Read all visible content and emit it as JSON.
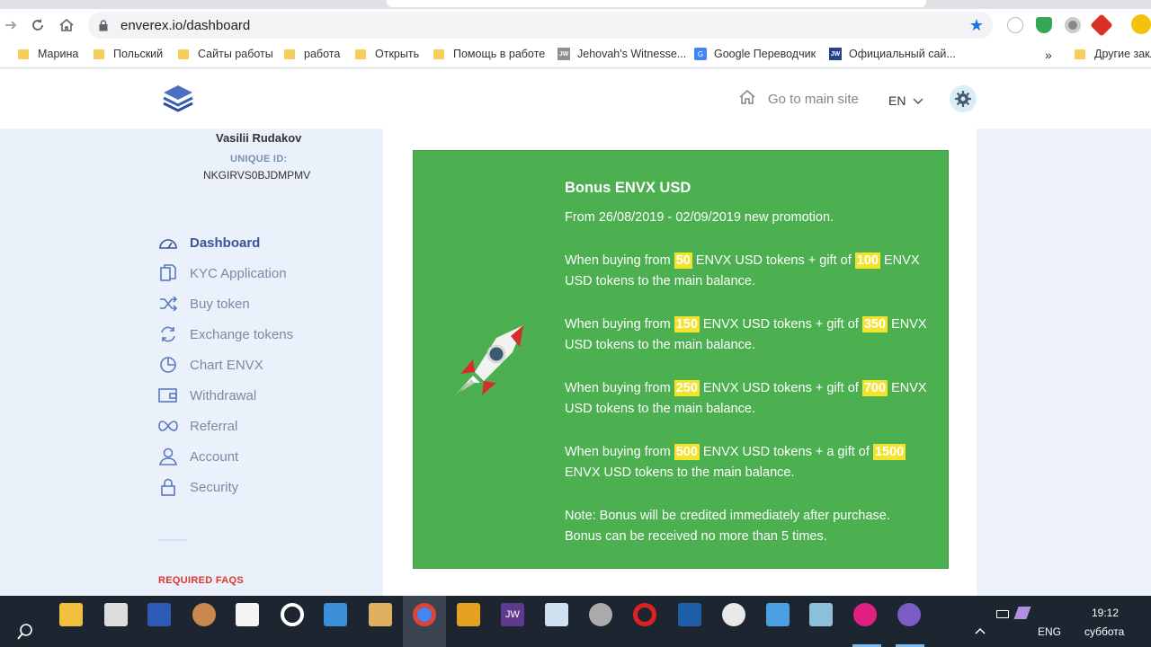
{
  "browser": {
    "url": "enverex.io/dashboard",
    "bookmarks": [
      {
        "label": "Марина",
        "icon": "folder-icon"
      },
      {
        "label": "Польский",
        "icon": "folder-icon"
      },
      {
        "label": "Сайты работы",
        "icon": "folder-icon"
      },
      {
        "label": "работа",
        "icon": "folder-icon"
      },
      {
        "label": "Открыть",
        "icon": "folder-icon"
      },
      {
        "label": "Помощь в работе",
        "icon": "folder-icon"
      },
      {
        "label": "Jehovah's Witnesse...",
        "icon": "jw-icon"
      },
      {
        "label": "Google Переводчик",
        "icon": "google-translate-icon"
      },
      {
        "label": "Официальный сай...",
        "icon": "jw-icon"
      },
      {
        "label": "Другие закл",
        "icon": "folder-icon"
      }
    ],
    "jw_badge": "JW",
    "more_bookmarks": "»"
  },
  "header": {
    "go_main": "Go to main site",
    "language": "EN"
  },
  "sidebar": {
    "user_name": "Vasilii Rudakov",
    "unique_id_label": "UNIQUE ID:",
    "unique_id": "NKGIRVS0BJDMPMV",
    "items": [
      {
        "label": "Dashboard",
        "icon": "dashboard-icon",
        "active": true
      },
      {
        "label": "KYC Application",
        "icon": "documents-icon"
      },
      {
        "label": "Buy token",
        "icon": "shuffle-icon"
      },
      {
        "label": "Exchange tokens",
        "icon": "refresh-icon"
      },
      {
        "label": "Chart ENVX",
        "icon": "pie-chart-icon"
      },
      {
        "label": "Withdrawal",
        "icon": "wallet-icon"
      },
      {
        "label": "Referral",
        "icon": "infinity-icon"
      },
      {
        "label": "Account",
        "icon": "user-icon"
      },
      {
        "label": "Security",
        "icon": "lock-icon"
      }
    ],
    "faqs_label": "REQUIRED FAQS"
  },
  "bonus": {
    "title": "Bonus ENVX USD",
    "period": "From 26/08/2019 - 02/09/2019 new promotion.",
    "tiers": [
      {
        "pre": "When buying from ",
        "buy": "50",
        "mid": " ENVX USD tokens + gift of ",
        "gift": "100",
        "post": " ENVX USD tokens to the main balance."
      },
      {
        "pre": "When buying from ",
        "buy": "150",
        "mid": " ENVX USD tokens + gift of ",
        "gift": "350",
        "post": " ENVX USD tokens to the main balance."
      },
      {
        "pre": "When buying from ",
        "buy": "250",
        "mid": " ENVX USD tokens + gift of ",
        "gift": "700",
        "post": " ENVX USD tokens to the main balance."
      },
      {
        "pre": "When buying from ",
        "buy": "500",
        "mid": " ENVX USD tokens + a gift of ",
        "gift": "1500",
        "post": " ENVX USD tokens to the main balance."
      }
    ],
    "note_1": "Note: Bonus will be credited immediately after purchase.",
    "note_2": "Bonus can be received no more than 5 times."
  },
  "taskbar": {
    "jw_label": "JW",
    "lang": "ENG",
    "time": "19:12",
    "day": "суббота"
  },
  "colors": {
    "card_green": "#4caf50",
    "highlight_yellow": "#f4e22c",
    "nav_active": "#3c5499",
    "faqs_red": "#e0352b"
  }
}
